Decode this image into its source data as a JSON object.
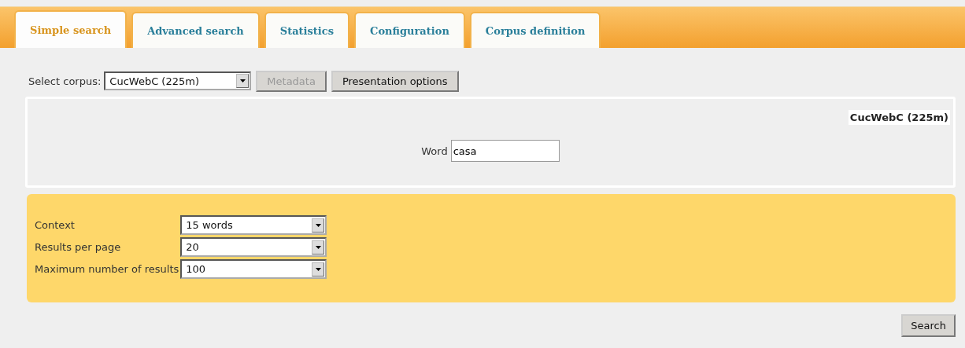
{
  "tabs": [
    {
      "label": "Simple search",
      "selected": true
    },
    {
      "label": "Advanced search",
      "selected": false
    },
    {
      "label": "Statistics",
      "selected": false
    },
    {
      "label": "Configuration",
      "selected": false
    },
    {
      "label": "Corpus definition",
      "selected": false
    }
  ],
  "corpus_bar": {
    "label": "Select corpus:",
    "value": "CucWebC (225m)",
    "buttons": [
      {
        "label": "Metadata",
        "disabled": true
      },
      {
        "label": "Presentation options",
        "disabled": false
      }
    ]
  },
  "query_panel": {
    "title": "CucWebC (225m)",
    "field_label": "Word",
    "field_value": "casa"
  },
  "options": [
    {
      "label": "Context",
      "value": "15 words"
    },
    {
      "label": "Results per page",
      "value": "20"
    },
    {
      "label": "Maximum number of results",
      "value": "100"
    }
  ],
  "search_button": "Search"
}
